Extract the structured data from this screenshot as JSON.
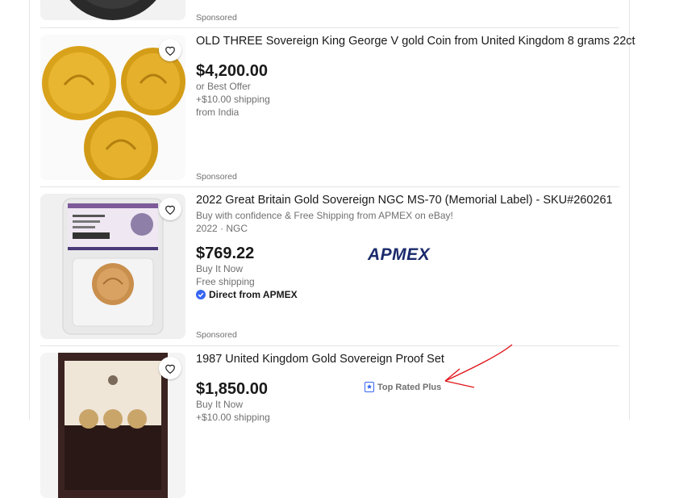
{
  "items": [
    {
      "sponsored": "Sponsored"
    },
    {
      "title": "OLD THREE Sovereign King George V gold Coin from United Kingdom 8 grams 22ct",
      "price": "$4,200.00",
      "offer": "or Best Offer",
      "shipping": "+$10.00 shipping",
      "origin": "from India",
      "sponsored": "Sponsored"
    },
    {
      "title": "2022 Great Britain Gold Sovereign NGC MS-70 (Memorial Label) - SKU#260261",
      "subtitle": "Buy with confidence & Free Shipping from APMEX on eBay!",
      "meta": "2022 · NGC",
      "price": "$769.22",
      "buy": "Buy It Now",
      "shipping": "Free shipping",
      "seller": "Direct from APMEX",
      "logo": "APMEX",
      "sponsored": "Sponsored"
    },
    {
      "title": "1987 United Kingdom Gold Sovereign Proof Set",
      "price": "$1,850.00",
      "buy": "Buy It Now",
      "shipping": "+$10.00 shipping",
      "badge": "Top Rated Plus"
    }
  ],
  "colors": {
    "accent_blue": "#3665f3",
    "annotation_red": "#e0151b",
    "apmex_navy": "#1a2a6c"
  }
}
